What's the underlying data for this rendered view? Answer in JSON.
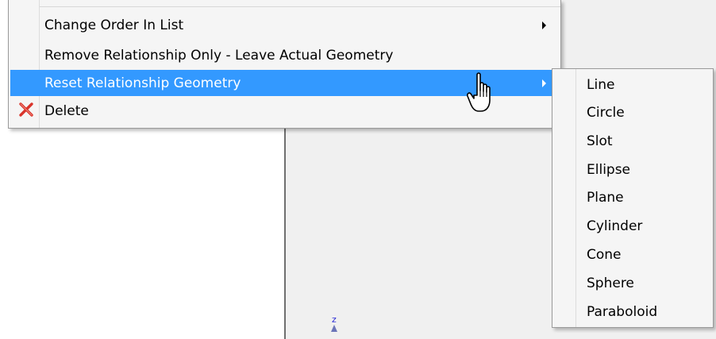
{
  "context_menu": {
    "items": [
      {
        "label": "Change Order In List",
        "has_submenu": true,
        "highlighted": false
      },
      {
        "label": "Remove Relationship Only - Leave Actual Geometry",
        "has_submenu": false,
        "highlighted": false
      },
      {
        "label": "Reset Relationship Geometry",
        "has_submenu": true,
        "highlighted": true
      },
      {
        "label": "Delete",
        "has_submenu": false,
        "highlighted": false,
        "icon": "red-x-icon"
      }
    ]
  },
  "submenu": {
    "items": [
      "Line",
      "Circle",
      "Slot",
      "Ellipse",
      "Plane",
      "Cylinder",
      "Cone",
      "Sphere",
      "Paraboloid"
    ]
  },
  "viewport": {
    "axis_label": "z"
  },
  "colors": {
    "highlight": "#3399ff",
    "delete_icon": "#d9342b",
    "axis": "#2a2ad6"
  }
}
